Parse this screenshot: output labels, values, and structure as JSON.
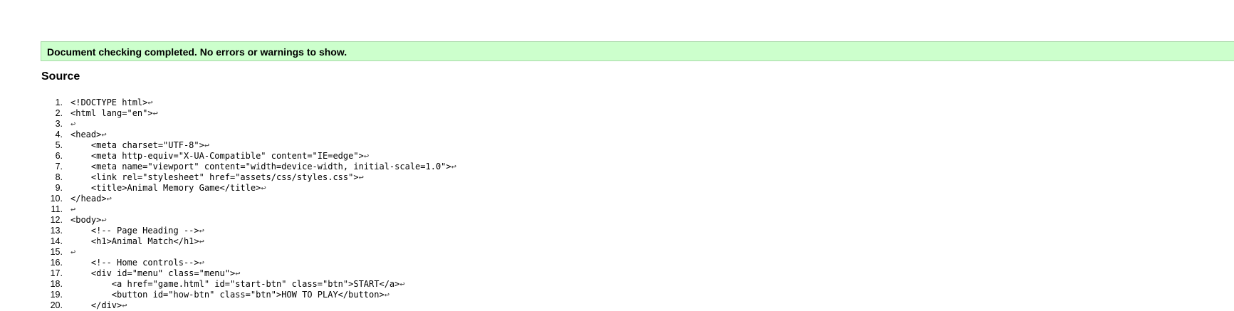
{
  "status": {
    "message": "Document checking completed. No errors or warnings to show."
  },
  "source": {
    "heading": "Source",
    "newline_glyph": "↩",
    "lines": [
      {
        "num": "1.",
        "code": "<!DOCTYPE html>"
      },
      {
        "num": "2.",
        "code": "<html lang=\"en\">"
      },
      {
        "num": "3.",
        "code": ""
      },
      {
        "num": "4.",
        "code": "<head>"
      },
      {
        "num": "5.",
        "code": "    <meta charset=\"UTF-8\">"
      },
      {
        "num": "6.",
        "code": "    <meta http-equiv=\"X-UA-Compatible\" content=\"IE=edge\">"
      },
      {
        "num": "7.",
        "code": "    <meta name=\"viewport\" content=\"width=device-width, initial-scale=1.0\">"
      },
      {
        "num": "8.",
        "code": "    <link rel=\"stylesheet\" href=\"assets/css/styles.css\">"
      },
      {
        "num": "9.",
        "code": "    <title>Animal Memory Game</title>"
      },
      {
        "num": "10.",
        "code": "</head>"
      },
      {
        "num": "11.",
        "code": ""
      },
      {
        "num": "12.",
        "code": "<body>"
      },
      {
        "num": "13.",
        "code": "    <!-- Page Heading -->"
      },
      {
        "num": "14.",
        "code": "    <h1>Animal Match</h1>"
      },
      {
        "num": "15.",
        "code": ""
      },
      {
        "num": "16.",
        "code": "    <!-- Home controls-->"
      },
      {
        "num": "17.",
        "code": "    <div id=\"menu\" class=\"menu\">"
      },
      {
        "num": "18.",
        "code": "        <a href=\"game.html\" id=\"start-btn\" class=\"btn\">START</a>"
      },
      {
        "num": "19.",
        "code": "        <button id=\"how-btn\" class=\"btn\">HOW TO PLAY</button>"
      },
      {
        "num": "20.",
        "code": "    </div>"
      }
    ]
  }
}
